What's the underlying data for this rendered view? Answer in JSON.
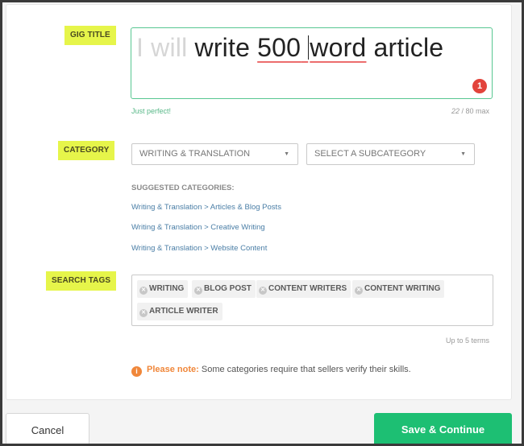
{
  "gig_title": {
    "label": "GIG TITLE",
    "prefix": "I will",
    "word1": "write",
    "err_part1": "500",
    "err_part2": "word",
    "word_last": "article",
    "error_count": "1",
    "hint": "Just perfect!",
    "count_current": "22",
    "count_max": "/ 80 max"
  },
  "category": {
    "label": "CATEGORY",
    "selected": "WRITING & TRANSLATION",
    "subcategory_placeholder": "SELECT A SUBCATEGORY",
    "suggested_heading": "SUGGESTED CATEGORIES:",
    "suggestions": [
      "Writing & Translation > Articles & Blog Posts",
      "Writing & Translation > Creative Writing",
      "Writing & Translation > Website Content"
    ]
  },
  "search_tags": {
    "label": "SEARCH TAGS",
    "tags": [
      "WRITING",
      "BLOG POST",
      "CONTENT WRITERS",
      "CONTENT WRITING",
      "ARTICLE WRITER"
    ],
    "limit_hint": "Up to 5 terms"
  },
  "note": {
    "lead": "Please note:",
    "text": " Some categories require that sellers verify their skills."
  },
  "actions": {
    "cancel": "Cancel",
    "save": "Save & Continue"
  },
  "colors": {
    "accent_green": "#1dbf73",
    "highlight_yellow": "#e6f54a",
    "error_red": "#e2433b",
    "note_orange": "#f0873a"
  }
}
